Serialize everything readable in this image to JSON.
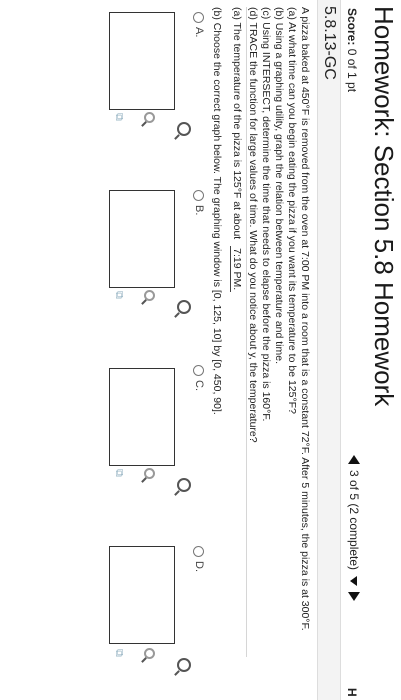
{
  "header": {
    "title": "Homework: Section 5.8 Homework",
    "score_label": "Score:",
    "score_value": "0 of 1 pt",
    "nav_text": "3 of 5 (2 complete)",
    "help_letter": "H"
  },
  "problem": {
    "id": "5.8.13-GC",
    "lines": [
      "A pizza baked at 450°F is removed from the oven at 7:00 PM into a room that is a constant 72°F. After 5 minutes, the pizza is at 300°F.",
      "(a) At what time can you begin eating the pizza if you want its temperature to be 125°F?",
      "(b) Using a graphing utility, graph the relation between temperature and time.",
      "(c) Using INTERSECT, determine the time that needs to elapse before the pizza is 160°F.",
      "(d) TRACE the function for large values of time. What do you notice about y, the temperature?"
    ],
    "part_a_prefix": "(a) The temperature of the pizza is 125°F at about",
    "part_a_answer": "7:19 PM.",
    "part_b_text": "(b) Choose the correct graph below. The graphing window is [0, 125, 10] by [0, 450, 90].",
    "options": [
      "A.",
      "B.",
      "C.",
      "D."
    ]
  }
}
